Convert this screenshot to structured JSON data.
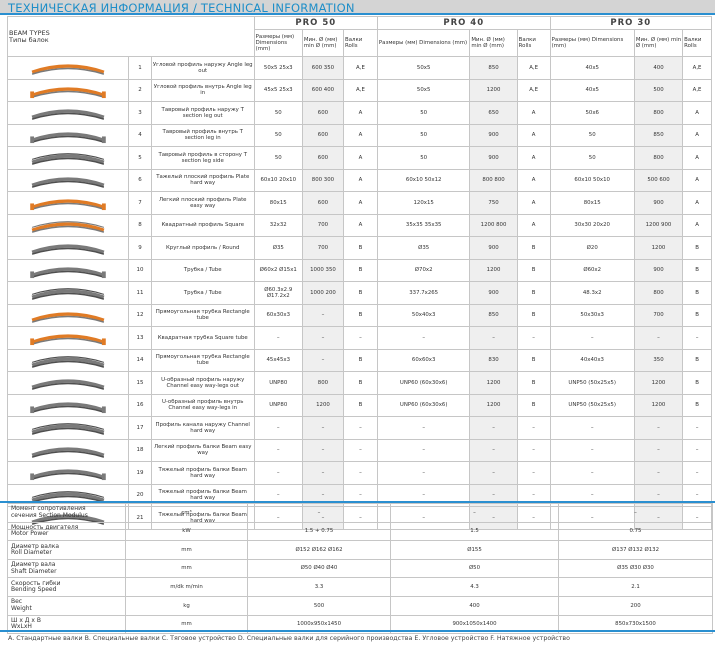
{
  "title": "ТЕХНИЧЕСКАЯ ИНФОРМАЦИЯ / TECHNICAL INFORMATION",
  "beam_types": {
    "en": "BEAM TYPES",
    "ru": "Типы балок"
  },
  "models": [
    "PRO 50",
    "PRO 40",
    "PRO 30"
  ],
  "subheaders": {
    "dim": "Размеры (мм) Dimensions (mm)",
    "min": "Мин. Ø (мм) min Ø (mm)",
    "rolls": "Валки Rolls"
  },
  "colors": {
    "accent": "#2a8fd0",
    "title": "#1e8ec8",
    "profile_orange": "#e07b25",
    "profile_grey": "#7a7a7a"
  },
  "rows": [
    {
      "n": "1",
      "name": "Угловой профиль наружу Angle leg out",
      "icon": "angle-profile-out-icon",
      "p50": [
        "50x5 25x3",
        "600 350",
        "A,E"
      ],
      "p40": [
        "50x5",
        "850",
        "A,E"
      ],
      "p30": [
        "40x5",
        "400",
        "A,E"
      ]
    },
    {
      "n": "2",
      "name": "Угловой профиль внутрь Angle leg in",
      "icon": "angle-profile-in-icon",
      "p50": [
        "45x5 25x3",
        "600 400",
        "A,E"
      ],
      "p40": [
        "50x5",
        "1200",
        "A,E"
      ],
      "p30": [
        "40x5",
        "500",
        "A,E"
      ]
    },
    {
      "n": "3",
      "name": "Тавровый профиль наружу T section leg out",
      "icon": "t-profile-out-icon",
      "p50": [
        "50",
        "600",
        "A"
      ],
      "p40": [
        "50",
        "650",
        "A"
      ],
      "p30": [
        "50x6",
        "800",
        "A"
      ]
    },
    {
      "n": "4",
      "name": "Тавровый профиль внутрь T section leg in",
      "icon": "t-profile-in-icon",
      "p50": [
        "50",
        "600",
        "A"
      ],
      "p40": [
        "50",
        "900",
        "A"
      ],
      "p30": [
        "50",
        "850",
        "A"
      ]
    },
    {
      "n": "5",
      "name": "Тавровый профиль в сторону T section leg side",
      "icon": "t-profile-side-icon",
      "p50": [
        "50",
        "600",
        "A"
      ],
      "p40": [
        "50",
        "900",
        "A"
      ],
      "p30": [
        "50",
        "800",
        "A"
      ]
    },
    {
      "n": "6",
      "name": "Тажелый плоский профиль Plate hard way",
      "icon": "plate-hard-icon",
      "p50": [
        "60x10 20x10",
        "800 300",
        "A"
      ],
      "p40": [
        "60x10 50x12",
        "800 800",
        "A"
      ],
      "p30": [
        "60x10 50x10",
        "500 600",
        "A"
      ]
    },
    {
      "n": "7",
      "name": "Легкий плоский профиль Plate easy way",
      "icon": "plate-easy-icon",
      "p50": [
        "80x15",
        "600",
        "A"
      ],
      "p40": [
        "120x15",
        "750",
        "A"
      ],
      "p30": [
        "80x15",
        "900",
        "A"
      ]
    },
    {
      "n": "8",
      "name": "Квадратный профиль Square",
      "icon": "square-profile-icon",
      "p50": [
        "32x32",
        "700",
        "A"
      ],
      "p40": [
        "35x35 35x35",
        "1200 800",
        "A"
      ],
      "p30": [
        "30x30 20x20",
        "1200 900",
        "A"
      ]
    },
    {
      "n": "9",
      "name": "Круглый профиль / Round",
      "icon": "round-profile-icon",
      "p50": [
        "Ø35",
        "700",
        "B"
      ],
      "p40": [
        "Ø35",
        "900",
        "B"
      ],
      "p30": [
        "Ø20",
        "1200",
        "B"
      ]
    },
    {
      "n": "10",
      "name": "Трубка / Tube",
      "icon": "tube-icon",
      "p50": [
        "Ø60x2 Ø15x1",
        "1000 350",
        "B"
      ],
      "p40": [
        "Ø70x2",
        "1200",
        "B"
      ],
      "p30": [
        "Ø60x2",
        "900",
        "B"
      ]
    },
    {
      "n": "11",
      "name": "Трубка / Tube",
      "icon": "tube-large-icon",
      "p50": [
        "Ø60.3x2.9 Ø17.2x2",
        "1000 200",
        "B"
      ],
      "p40": [
        "337.7x265",
        "900",
        "B"
      ],
      "p30": [
        "48.3x2",
        "800",
        "B"
      ]
    },
    {
      "n": "12",
      "name": "Прямоугольная трубка Rectangle tube",
      "icon": "rect-tube-icon",
      "p50": [
        "60x30x3",
        "–",
        "B"
      ],
      "p40": [
        "50x40x3",
        "850",
        "B"
      ],
      "p30": [
        "50x30x3",
        "700",
        "B"
      ]
    },
    {
      "n": "13",
      "name": "Квадратная трубка Square tube",
      "icon": "square-tube-icon",
      "p50": [
        "–",
        "–",
        "–"
      ],
      "p40": [
        "–",
        "–",
        "–"
      ],
      "p30": [
        "–",
        "–",
        "–"
      ]
    },
    {
      "n": "14",
      "name": "Прямоугольная трубка Rectangle tube",
      "icon": "rect-tube-2-icon",
      "p50": [
        "45x45x3",
        "–",
        "B"
      ],
      "p40": [
        "60x60x3",
        "830",
        "B"
      ],
      "p30": [
        "40x40x3",
        "350",
        "B"
      ]
    },
    {
      "n": "15",
      "name": "U-образный профиль наружу Channel easy way-legs out",
      "icon": "channel-out-icon",
      "p50": [
        "UNP80",
        "800",
        "B"
      ],
      "p40": [
        "UNP60 (60x30x6)",
        "1200",
        "B"
      ],
      "p30": [
        "UNP50 (50x25x5)",
        "1200",
        "B"
      ]
    },
    {
      "n": "16",
      "name": "U-образный профиль внутрь Channel easy way-legs in",
      "icon": "channel-in-icon",
      "p50": [
        "UNP80",
        "1200",
        "B"
      ],
      "p40": [
        "UNP60 (60x30x6)",
        "1200",
        "B"
      ],
      "p30": [
        "UNP50 (50x25x5)",
        "1200",
        "B"
      ]
    },
    {
      "n": "17",
      "name": "Профиль канала наружу Channel hard way",
      "icon": "channel-hard-icon",
      "p50": [
        "–",
        "–",
        "–"
      ],
      "p40": [
        "–",
        "–",
        "–"
      ],
      "p30": [
        "–",
        "–",
        "–"
      ]
    },
    {
      "n": "18",
      "name": "Легкий профиль балки Beam easy way",
      "icon": "beam-easy-icon",
      "p50": [
        "–",
        "–",
        "–"
      ],
      "p40": [
        "–",
        "–",
        "–"
      ],
      "p30": [
        "–",
        "–",
        "–"
      ]
    },
    {
      "n": "19",
      "name": "Тяжелый профиль балки Beam hard way",
      "icon": "beam-hard-icon",
      "p50": [
        "–",
        "–",
        "–"
      ],
      "p40": [
        "–",
        "–",
        "–"
      ],
      "p30": [
        "–",
        "–",
        "–"
      ]
    },
    {
      "n": "20",
      "name": "Тяжелый профиль балки Beam hard way",
      "icon": "beam-hard-2-icon",
      "p50": [
        "–",
        "–",
        "–"
      ],
      "p40": [
        "–",
        "–",
        "–"
      ],
      "p30": [
        "–",
        "–",
        "–"
      ]
    },
    {
      "n": "21",
      "name": "Тяжелый профиль балки Beam hard way",
      "icon": "beam-hard-3-icon",
      "p50": [
        "–",
        "–",
        "–"
      ],
      "p40": [
        "–",
        "–",
        "–"
      ],
      "p30": [
        "–",
        "–",
        "–"
      ]
    }
  ],
  "params": [
    {
      "ru": "Момент сопротивления",
      "en": "сечения Section Modulus",
      "unit": "cm³",
      "v": [
        "–",
        "–",
        "–"
      ]
    },
    {
      "ru": "Мощность двигателя",
      "en": "Motor Power",
      "unit": "kW",
      "v": [
        "1.5 + 0.75",
        "1.5",
        "0.75"
      ]
    },
    {
      "ru": "Диаметр валка",
      "en": "Roll Diameter",
      "unit": "mm",
      "v": [
        "Ø152 Ø162 Ø162",
        "Ø155",
        "Ø137 Ø132 Ø132"
      ]
    },
    {
      "ru": "Диаметр вала",
      "en": "Shaft Diameter",
      "unit": "mm",
      "v": [
        "Ø50 Ø40 Ø40",
        "Ø50",
        "Ø35 Ø30 Ø30"
      ]
    },
    {
      "ru": "Скорость гибки",
      "en": "Bending Speed",
      "unit": "m/dk m/min",
      "v": [
        "3.3",
        "4.3",
        "2.1"
      ]
    },
    {
      "ru": "Вес",
      "en": "Weight",
      "unit": "kg",
      "v": [
        "500",
        "400",
        "200"
      ]
    },
    {
      "ru": "Ш х Д х В",
      "en": "WxLxH",
      "unit": "mm",
      "v": [
        "1000x950x1450",
        "900x1050x1400",
        "850x730x1500"
      ]
    }
  ],
  "footer": "A. Стандартные валки B. Специальные валки C. Тяговое устройство D. Специальные валки для серийного производства E. Угловое устройство F. Натяжное устройство"
}
